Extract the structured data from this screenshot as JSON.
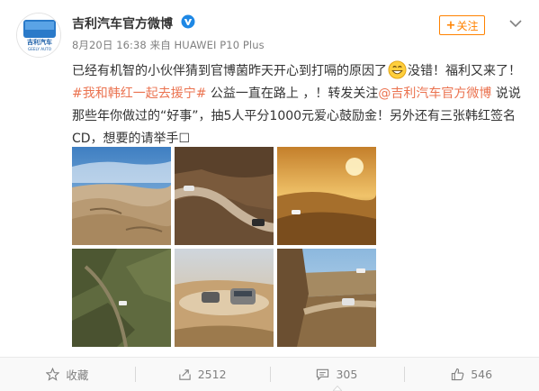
{
  "post": {
    "author": "吉利汽车官方微博",
    "verified_icon": "verified-v-icon",
    "meta": "8月20日 16:38 来自 HUAWEI P10 Plus",
    "follow_label": "关注",
    "more_icon": "chevron-down-icon",
    "avatar_logo": "geely-auto-logo",
    "avatar_brand_cn": "吉利汽车",
    "avatar_brand_en": "GEELY AUTO"
  },
  "text": {
    "part1": "已经有机智的小伙伴猜到官博菌昨天开心到打嗝的原因了",
    "emoji": "grin-emoji",
    "part2": "没错！福利又来了！",
    "hashtag": "#我和韩红一起去援宁#",
    "part3": " 公益一直在路上 ，！转发关注",
    "mention": "@吉利汽车官方微博",
    "part4": " 说说那些年你做过的“好事”，抽5人平分1000元爱心鼓励金！另外还有三张韩红签名CD，想要的请举手☐"
  },
  "gallery": [
    {
      "name": "photo-desert-dunes"
    },
    {
      "name": "photo-mountain-road-suv"
    },
    {
      "name": "photo-sunset-dunes"
    },
    {
      "name": "photo-rocky-terrain-aerial"
    },
    {
      "name": "photo-two-suvs-dust"
    },
    {
      "name": "photo-suv-cliff-road"
    }
  ],
  "actions": {
    "favorite_label": "收藏",
    "repost_count": "2512",
    "comment_count": "305",
    "like_count": "546"
  },
  "colors": {
    "accent": "#ff8200",
    "link": "#eb7350",
    "text": "#333333",
    "muted": "#808080"
  }
}
